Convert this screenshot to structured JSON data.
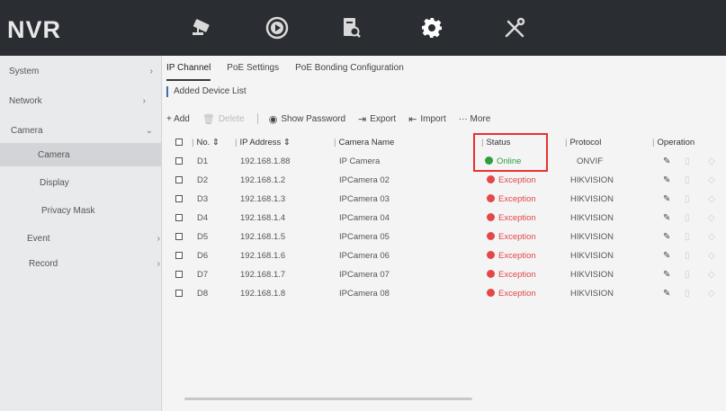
{
  "app": {
    "logo": "NVR"
  },
  "top_nav": [
    {
      "name": "camera-nav-icon"
    },
    {
      "name": "playback-nav-icon"
    },
    {
      "name": "search-nav-icon"
    },
    {
      "name": "settings-nav-icon"
    },
    {
      "name": "maintenance-nav-icon"
    }
  ],
  "sidebar": {
    "items": [
      {
        "label": "System",
        "chevron": "›"
      },
      {
        "label": "Network",
        "chevron": "›"
      },
      {
        "label": "Camera",
        "chevron": "⌄"
      },
      {
        "label": "Camera"
      },
      {
        "label": "Display"
      },
      {
        "label": "Privacy Mask"
      },
      {
        "label": "Event",
        "chevron": "›"
      },
      {
        "label": "Record",
        "chevron": "›"
      }
    ]
  },
  "tabs": [
    {
      "label": "IP Channel",
      "active": true
    },
    {
      "label": "PoE Settings"
    },
    {
      "label": "PoE Bonding Configuration"
    }
  ],
  "section_title": "Added Device List",
  "toolbar": {
    "add": "+ Add",
    "delete": "Delete",
    "show_password": "Show Password",
    "export": "Export",
    "import": "Import",
    "more": "··· More"
  },
  "table": {
    "headers": {
      "no": "No. ⇕",
      "ip": "IP Address ⇕",
      "name": "Camera Name",
      "status": "Status",
      "protocol": "Protocol",
      "operation": "Operation"
    },
    "rows": [
      {
        "no": "D1",
        "ip": "192.168.1.88",
        "name": "IP Camera",
        "status": "Online",
        "protocol": "ONVIF"
      },
      {
        "no": "D2",
        "ip": "192.168.1.2",
        "name": "IPCamera 02",
        "status": "Exception",
        "protocol": "HIKVISION"
      },
      {
        "no": "D3",
        "ip": "192.168.1.3",
        "name": "IPCamera 03",
        "status": "Exception",
        "protocol": "HIKVISION"
      },
      {
        "no": "D4",
        "ip": "192.168.1.4",
        "name": "IPCamera 04",
        "status": "Exception",
        "protocol": "HIKVISION"
      },
      {
        "no": "D5",
        "ip": "192.168.1.5",
        "name": "IPCamera 05",
        "status": "Exception",
        "protocol": "HIKVISION"
      },
      {
        "no": "D6",
        "ip": "192.168.1.6",
        "name": "IPCamera 06",
        "status": "Exception",
        "protocol": "HIKVISION"
      },
      {
        "no": "D7",
        "ip": "192.168.1.7",
        "name": "IPCamera 07",
        "status": "Exception",
        "protocol": "HIKVISION"
      },
      {
        "no": "D8",
        "ip": "192.168.1.8",
        "name": "IPCamera 08",
        "status": "Exception",
        "protocol": "HIKVISION"
      }
    ]
  },
  "colors": {
    "online": "#2e9e3e",
    "exception": "#e34848",
    "highlight": "#e8322f"
  }
}
